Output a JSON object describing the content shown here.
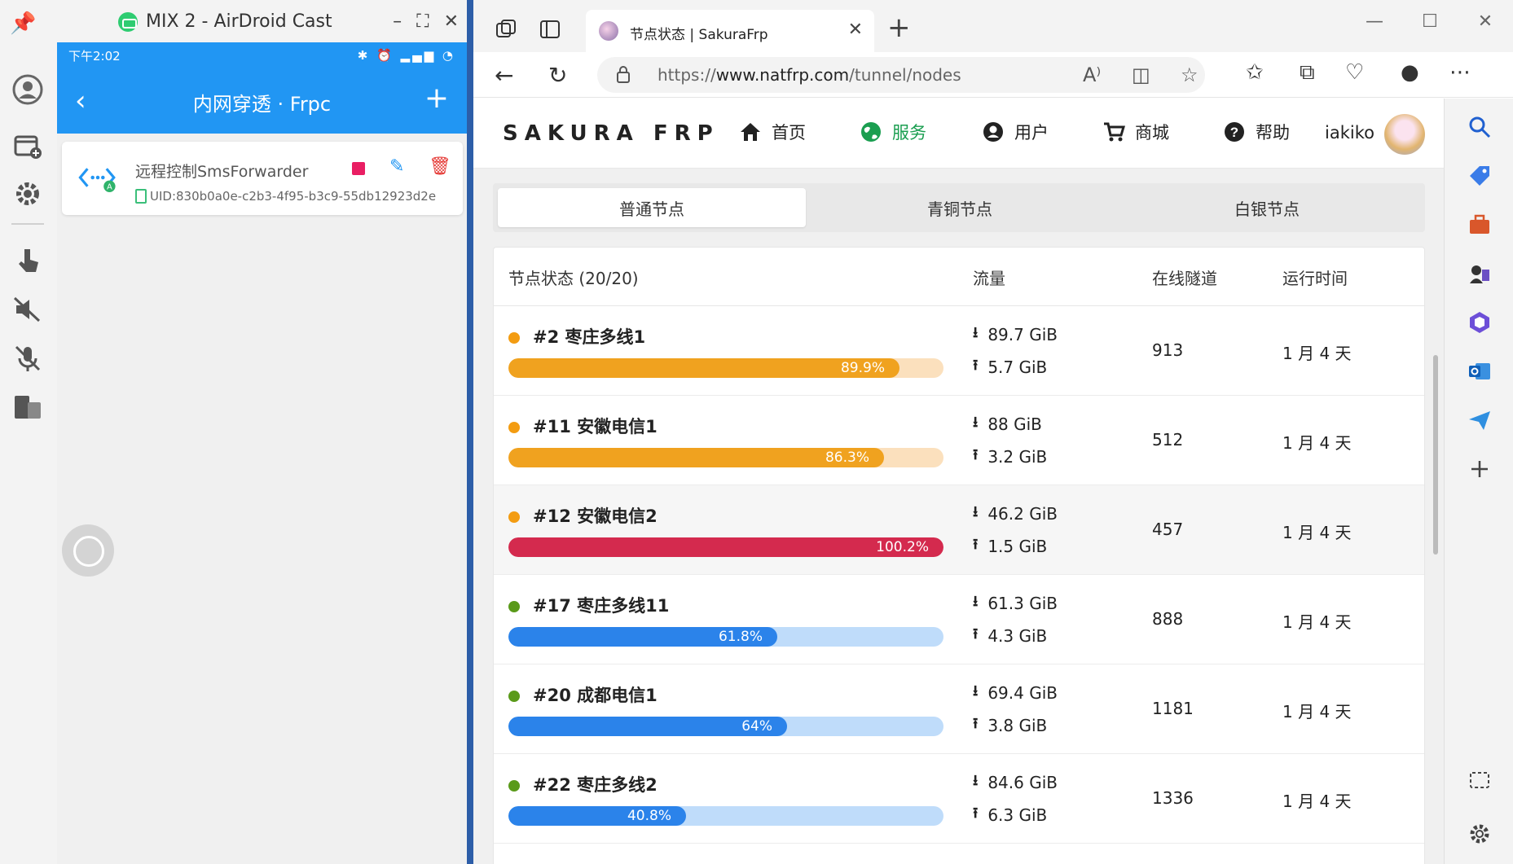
{
  "airdroid": {
    "window_title": "MIX 2 - AirDroid Cast",
    "controls": [
      "–",
      "⛶",
      "✕"
    ],
    "sidebar_icons": [
      "user-icon",
      "add-window-icon",
      "settings-icon",
      "touch-icon",
      "mute-speaker-icon",
      "mute-mic-icon",
      "devices-icon"
    ]
  },
  "phone": {
    "status_time": "下午2:02",
    "status_right": "✱ ⏰ ▂▄▆ ◔",
    "app_title": "内网穿透 · Frpc",
    "back_icon": "‹",
    "add_icon": "+",
    "card": {
      "name": "远程控制SmsForwarder",
      "uid": "UID:830b0a0e-c2b3-4f95-b3c9-55db12923d2e"
    }
  },
  "browser": {
    "tab_title": "节点状态 | SakuraFrp",
    "url_prefix": "https://",
    "url_domain": "www.natfrp.com",
    "url_path": "/tunnel/nodes"
  },
  "site": {
    "logo": "SAKURA FRP",
    "nav": [
      {
        "label": "首页",
        "icon": "home-icon"
      },
      {
        "label": "服务",
        "icon": "globe-icon"
      },
      {
        "label": "用户",
        "icon": "user-icon"
      },
      {
        "label": "商城",
        "icon": "cart-icon"
      },
      {
        "label": "帮助",
        "icon": "help-icon"
      }
    ],
    "username": "iakiko",
    "accent": "#1a9e50"
  },
  "node_tabs": [
    "普通节点",
    "青铜节点",
    "白银节点"
  ],
  "table": {
    "headers": [
      "节点状态 (20/20)",
      "流量",
      "在线隧道",
      "运行时间"
    ],
    "rows": [
      {
        "name": "#2 枣庄多线1",
        "status_color": "#f39c12",
        "load": 89.9,
        "load_label": "89.9%",
        "bar_color": "#f0a21f",
        "track_color": "#fbe0bd",
        "download": "89.7 GiB",
        "upload": "5.7 GiB",
        "online": "913",
        "uptime": "1 月 4 天"
      },
      {
        "name": "#11 安徽电信1",
        "status_color": "#f39c12",
        "load": 86.3,
        "load_label": "86.3%",
        "bar_color": "#f0a21f",
        "track_color": "#fbe0bd",
        "download": "88 GiB",
        "upload": "3.2 GiB",
        "online": "512",
        "uptime": "1 月 4 天"
      },
      {
        "name": "#12 安徽电信2",
        "status_color": "#f39c12",
        "load": 100.0,
        "load_label": "100.2%",
        "bar_color": "#d42a4e",
        "track_color": "#f4c6d0",
        "download": "46.2 GiB",
        "upload": "1.5 GiB",
        "online": "457",
        "uptime": "1 月 4 天"
      },
      {
        "name": "#17 枣庄多线11",
        "status_color": "#5a9a1a",
        "load": 61.8,
        "load_label": "61.8%",
        "bar_color": "#2b83ea",
        "track_color": "#bfdcfa",
        "download": "61.3 GiB",
        "upload": "4.3 GiB",
        "online": "888",
        "uptime": "1 月 4 天"
      },
      {
        "name": "#20 成都电信1",
        "status_color": "#5a9a1a",
        "load": 64,
        "load_label": "64%",
        "bar_color": "#2b83ea",
        "track_color": "#bfdcfa",
        "download": "69.4 GiB",
        "upload": "3.8 GiB",
        "online": "1181",
        "uptime": "1 月 4 天"
      },
      {
        "name": "#22 枣庄多线2",
        "status_color": "#5a9a1a",
        "load": 40.8,
        "load_label": "40.8%",
        "bar_color": "#2b83ea",
        "track_color": "#bfdcfa",
        "download": "84.6 GiB",
        "upload": "6.3 GiB",
        "online": "1336",
        "uptime": "1 月 4 天"
      }
    ]
  }
}
